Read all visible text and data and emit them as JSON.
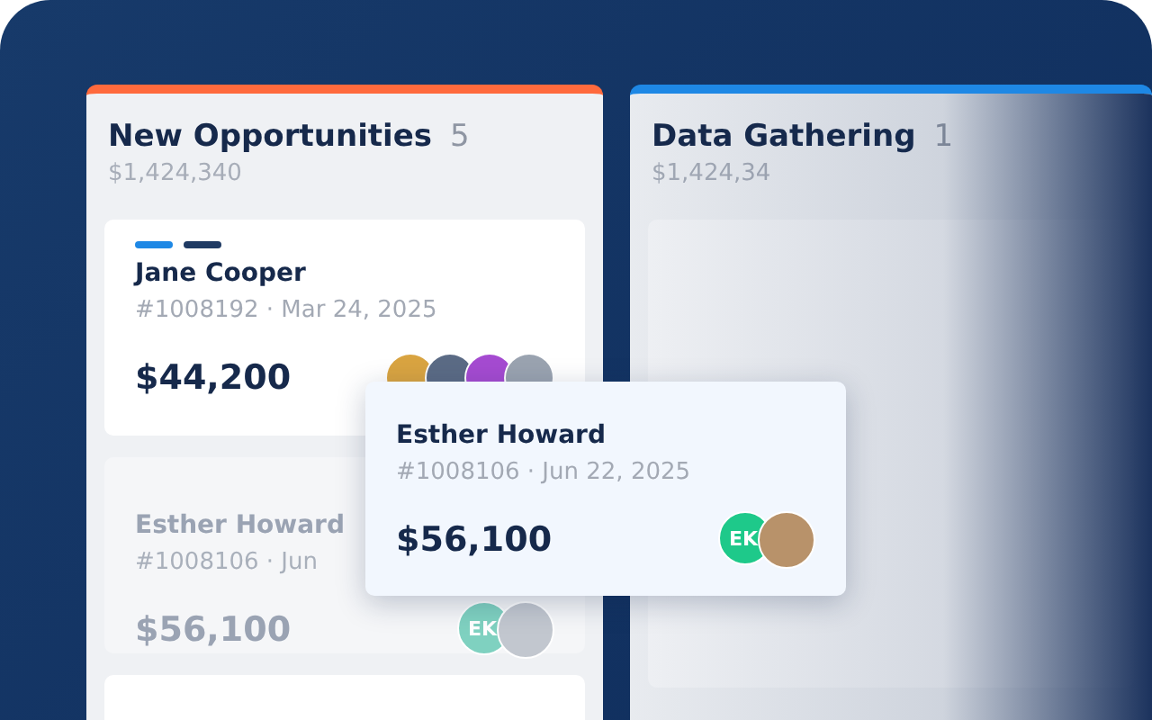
{
  "columns": [
    {
      "title": "New Opportunities",
      "count": "5",
      "total": "$1,424,340",
      "color": "#ff6a3d",
      "faded": false,
      "cards": [
        {
          "kind": "deal",
          "dimmed": false,
          "tags": [
            {
              "color": "#1e88e5"
            },
            {
              "color": "#1f3a63"
            }
          ],
          "name": "Jane Cooper",
          "meta": "#1008192 · Mar 24, 2025",
          "amount": "$44,200",
          "avatars": [
            {
              "kind": "photo",
              "color": "#d9a441"
            },
            {
              "kind": "photo",
              "color": "#5b6b85"
            },
            {
              "kind": "photo",
              "color": "#a54bd1"
            },
            {
              "kind": "photo",
              "color": "#9aa3b0"
            }
          ]
        },
        {
          "kind": "deal",
          "dimmed": true,
          "name": "Esther Howard",
          "meta": "#1008106 · Jun",
          "amount": "$56,100",
          "avatars": [
            {
              "kind": "initials",
              "initials": "EK",
              "color": "#7fd1c0"
            },
            {
              "kind": "photo",
              "color": "#c2c7cf"
            }
          ]
        },
        {
          "kind": "blank"
        }
      ]
    },
    {
      "title": "Data Gathering",
      "count": "1",
      "total": "$1,424,34",
      "color": "#1e88e5",
      "faded": true,
      "cards": [
        {
          "kind": "blank"
        }
      ]
    }
  ],
  "dragged_card": {
    "name": "Esther Howard",
    "meta": "#1008106 · Jun 22, 2025",
    "amount": "$56,100",
    "avatars": [
      {
        "kind": "initials",
        "initials": "EK",
        "color": "#1ec98a"
      },
      {
        "kind": "photo",
        "color": "#b8926a"
      }
    ]
  }
}
